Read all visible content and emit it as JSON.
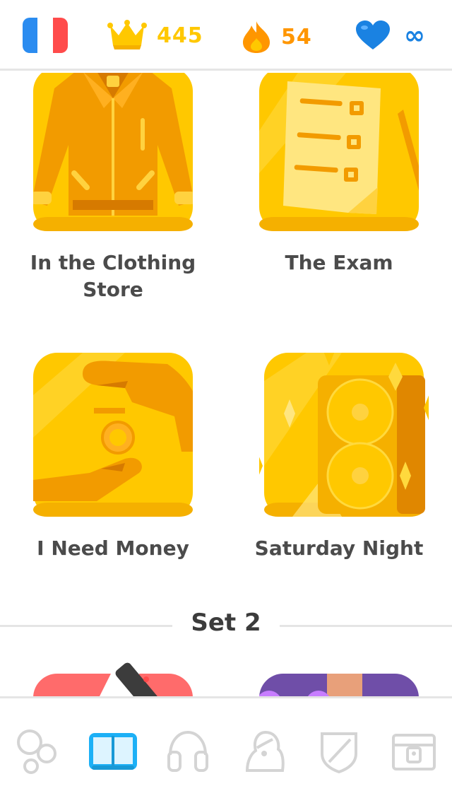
{
  "header": {
    "language_flag": "france-flag-icon",
    "crowns": "445",
    "streak": "54",
    "hearts": "∞"
  },
  "skills": [
    {
      "label": "In the Clothing Store",
      "icon": "jacket-icon"
    },
    {
      "label": "The Exam",
      "icon": "exam-paper-icon"
    },
    {
      "label": "I Need Money",
      "icon": "money-hands-icon"
    },
    {
      "label": "Saturday Night",
      "icon": "speaker-icon"
    }
  ],
  "set_divider": {
    "title": "Set 2"
  },
  "nav": [
    {
      "name": "circles-icon",
      "active": false
    },
    {
      "name": "book-icon",
      "active": true
    },
    {
      "name": "headphones-icon",
      "active": false
    },
    {
      "name": "character-icon",
      "active": false
    },
    {
      "name": "shield-icon",
      "active": false
    },
    {
      "name": "chest-icon",
      "active": false
    }
  ],
  "colors": {
    "gold": "#ffc800",
    "gold_dark": "#f29b00",
    "streak_orange": "#ff9600",
    "heart_blue": "#1cb0f6",
    "text": "#4b4b4b",
    "border": "#e5e5e5"
  }
}
